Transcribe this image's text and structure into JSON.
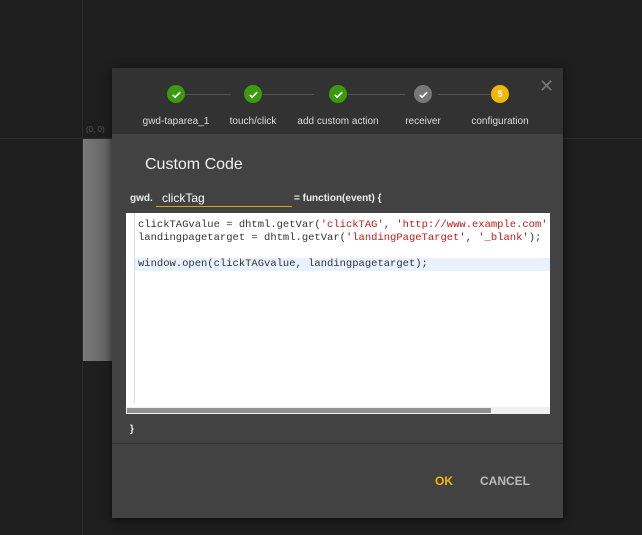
{
  "canvas": {
    "coord_label": "(0, 0)"
  },
  "dialog": {
    "steps": [
      {
        "label": "gwd-taparea_1",
        "state": "done"
      },
      {
        "label": "touch/click",
        "state": "done"
      },
      {
        "label": "add custom action",
        "state": "done"
      },
      {
        "label": "receiver",
        "state": "done-inactive"
      },
      {
        "label": "configuration",
        "state": "current",
        "number": "5"
      }
    ],
    "close_icon": "close-icon",
    "title": "Custom Code",
    "prefix": "gwd.",
    "function_name": "clickTag",
    "function_suffix": "= function(event) {",
    "code_lines": [
      {
        "a": "clickTAGvalue = dhtml.getVar(",
        "s1": "'clickTAG'",
        "b": ", ",
        "s2": "'http://www.example.com'",
        "c": ""
      },
      {
        "a": "landingpagetarget = dhtml.getVar(",
        "s1": "'landingPageTarget'",
        "b": ", ",
        "s2": "'_blank'",
        "c": ");"
      },
      {
        "a": "window.open(clickTAGvalue, landingpagetarget);"
      }
    ],
    "closing_brace": "}",
    "ok_label": "OK",
    "cancel_label": "CANCEL"
  },
  "colors": {
    "done": "#3c9a0e",
    "inactive": "#777777",
    "current": "#f2b705",
    "accent": "#e0a400"
  }
}
